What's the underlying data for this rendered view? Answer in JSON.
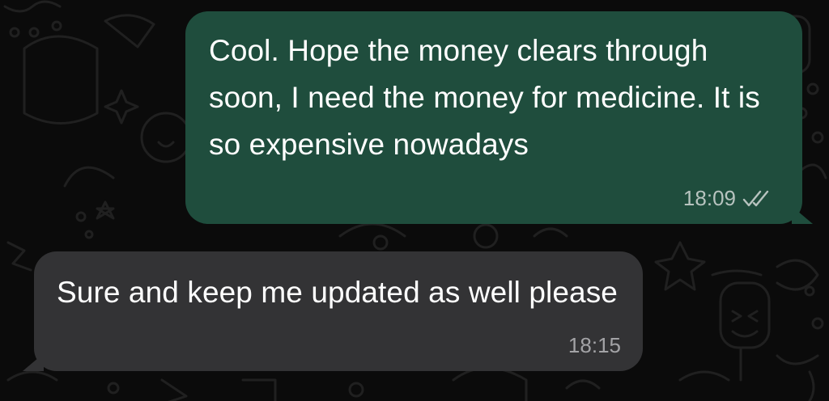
{
  "chat": {
    "messages": [
      {
        "direction": "outgoing",
        "text": "Cool. Hope the money clears through soon, I need the money for medicine. It is so expensive nowadays",
        "time": "18:09",
        "status_icon": "double-check-icon"
      },
      {
        "direction": "incoming",
        "text": "Sure and keep me updated as well please",
        "time": "18:15"
      }
    ]
  },
  "colors": {
    "background": "#0b0b0b",
    "outgoing_bubble": "#1f4d3d",
    "incoming_bubble": "#333335",
    "text": "#ffffff",
    "timestamp": "#b7c3bf"
  }
}
